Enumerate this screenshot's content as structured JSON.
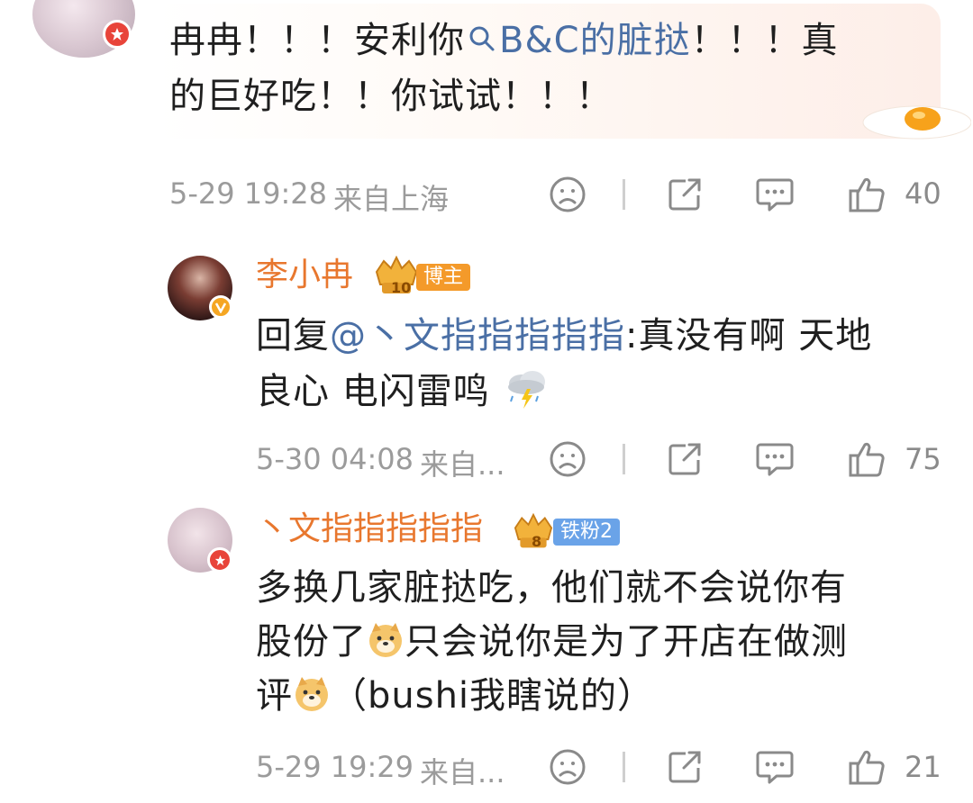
{
  "comment1": {
    "text_a": "冉冉！！！安利你",
    "link": "B&C的脏挞",
    "text_b": "！！！真",
    "line2": "的巨好吃！！你试试！！！",
    "time": "5-29 19:28",
    "location": "来自上海",
    "likes": "40"
  },
  "reply1": {
    "author": "李小冉",
    "tag_num": "10",
    "tag": "博主",
    "reply_prefix": "回复",
    "mention": "@丶文指指指指指",
    "text_a": ":真没有啊 天地",
    "line2": "良心 电闪雷鸣",
    "time": "5-30 04:08",
    "location": "来自...",
    "likes": "75"
  },
  "reply2": {
    "author": "丶文指指指指指",
    "tag_num": "8",
    "tag": "铁粉2",
    "line1": "多换几家脏挞吃，他们就不会说你有",
    "line2a": "股份了",
    "line2b": "只会说你是为了开店在做测",
    "line3a": "评",
    "line3b": "（bushi我瞎说的）",
    "time": "5-29 19:29",
    "location": "来自...",
    "likes": "21"
  },
  "colors": {
    "accent_name": "#e8772e",
    "link": "#4a6fa5",
    "meta": "#9b9b9b",
    "badge_red": "#e8443a",
    "tag_orange": "#f49a2a",
    "tag_blue": "#6aa3e8"
  },
  "icons": [
    "dislike-face-icon",
    "share-icon",
    "comment-icon",
    "like-thumb-icon",
    "egg-icon",
    "thunderstorm-emoji-icon",
    "doge-emoji-icon",
    "search-link-icon",
    "crown-badge-icon"
  ]
}
